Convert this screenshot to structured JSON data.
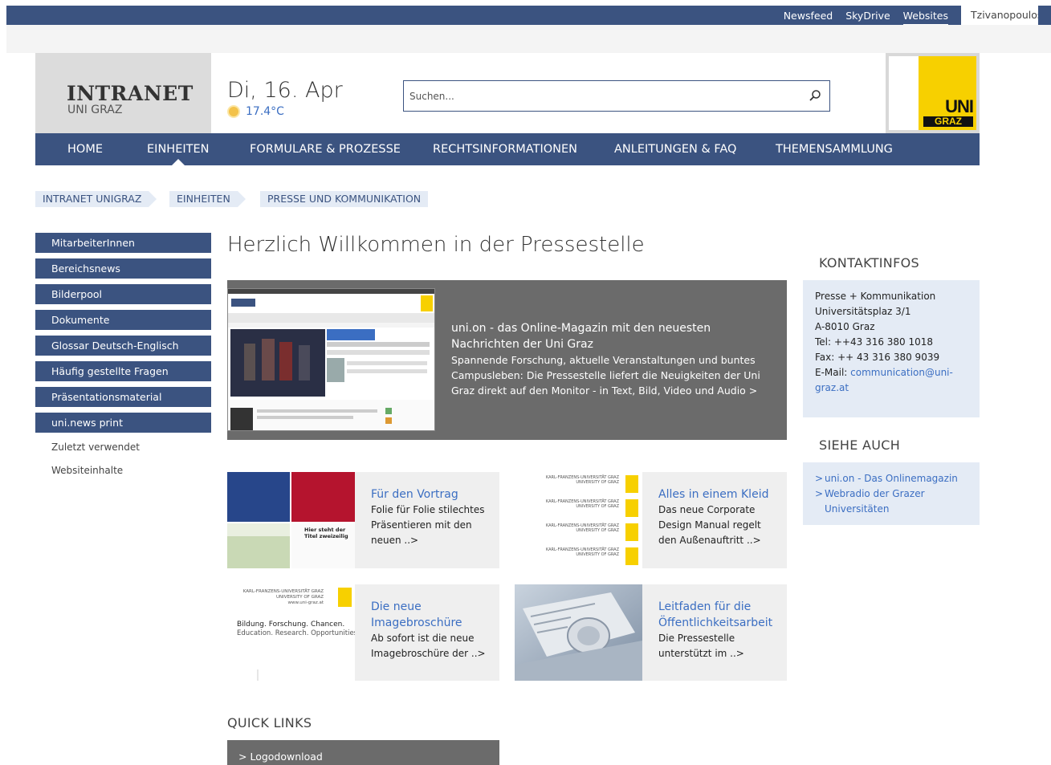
{
  "suitebar": {
    "links": [
      "Newsfeed",
      "SkyDrive",
      "Websites"
    ],
    "active": "Websites",
    "user": "Tzivanopoulos, K"
  },
  "brand": {
    "title": "INTRANET",
    "subtitle": "UNI GRAZ"
  },
  "date": {
    "text": "Di, 16. Apr",
    "temperature": "17.4°C",
    "weather_icon": "sun-icon"
  },
  "search": {
    "placeholder": "Suchen...",
    "icon": "search-icon"
  },
  "logo": {
    "line1": "UNI",
    "line2": "GRAZ"
  },
  "mainnav": {
    "items": [
      "HOME",
      "EINHEITEN",
      "FORMULARE & PROZESSE",
      "RECHTSINFORMATIONEN",
      "ANLEITUNGEN & FAQ",
      "THEMENSAMMLUNG"
    ],
    "active": "EINHEITEN"
  },
  "breadcrumb": [
    "INTRANET UNIGRAZ",
    "EINHEITEN",
    "PRESSE UND KOMMUNIKATION"
  ],
  "leftnav": {
    "items": [
      "MitarbeiterInnen",
      "Bereichsnews",
      "Bilderpool",
      "Dokumente",
      "Glossar Deutsch-Englisch",
      "Häufig gestellte Fragen",
      "Präsentationsmaterial",
      "uni.news print"
    ],
    "sub": [
      "Zuletzt verwendet",
      "Websiteinhalte"
    ]
  },
  "page": {
    "title": "Herzlich Willkommen in der Pressestelle"
  },
  "hero": {
    "headline": "uni.on - das Online-Magazin mit den neuesten Nachrichten der Uni Graz",
    "body": "Spannende Forschung, aktuelle Veranstaltungen und buntes Campusleben: Die Pressestelle liefert die Neuigkeiten der Uni Graz direkt auf den Monitor - in Text, Bild, Video und Audio >"
  },
  "tiles": [
    {
      "title": "Für den Vortrag",
      "desc": "Folie für Folie stilechtes Präsentieren mit den neuen ..>"
    },
    {
      "title": "Alles in einem Kleid",
      "desc": "Das neue Corporate Design Manual regelt den Außenauftritt ..>"
    },
    {
      "title": "Die neue Imagebroschüre",
      "desc": "Ab sofort ist die neue Imagebroschüre der ..>"
    },
    {
      "title": "Leitfaden für die Öffentlichkeitsarbeit",
      "desc": "Die Pressestelle unterstützt im ..>"
    }
  ],
  "tile_images": {
    "slide_caption": "Hier steht der Titel zweizeilig",
    "cd_lines": [
      "KARL-FRANZENS-UNIVERSITÄT GRAZ",
      "UNIVERSITY OF GRAZ"
    ],
    "brochure_header": [
      "KARL-FRANZENS-UNIVERSITÄT GRAZ",
      "UNIVERSITY OF GRAZ",
      "www.uni-graz.at"
    ],
    "brochure_claim_de": "Bildung. Forschung. Chancen.",
    "brochure_claim_en": "Education. Research. Opportunities."
  },
  "quicklinks": {
    "title": "QUICK LINKS",
    "items": [
      "> Logodownload"
    ]
  },
  "contact": {
    "title": "KONTAKTINFOS",
    "lines": [
      "Presse + Kommunikation",
      "Universitätsplaz 3/1",
      "A-8010 Graz",
      "Tel: ++43 316 380 1018",
      "Fax: ++ 43 316 380 9039"
    ],
    "email_label": "E-Mail:",
    "email": "communication@uni-graz.at"
  },
  "seealso": {
    "title": "SIEHE AUCH",
    "items": [
      "uni.on - Das Onlinemagazin",
      "Webradio der Grazer Universitäten"
    ]
  },
  "colors": {
    "brand_blue": "#3b5380",
    "link_blue": "#3b6ec2",
    "light_blue": "#e4ebf5",
    "dark_gray": "#6b6b6b",
    "logo_yellow": "#f7d000"
  }
}
